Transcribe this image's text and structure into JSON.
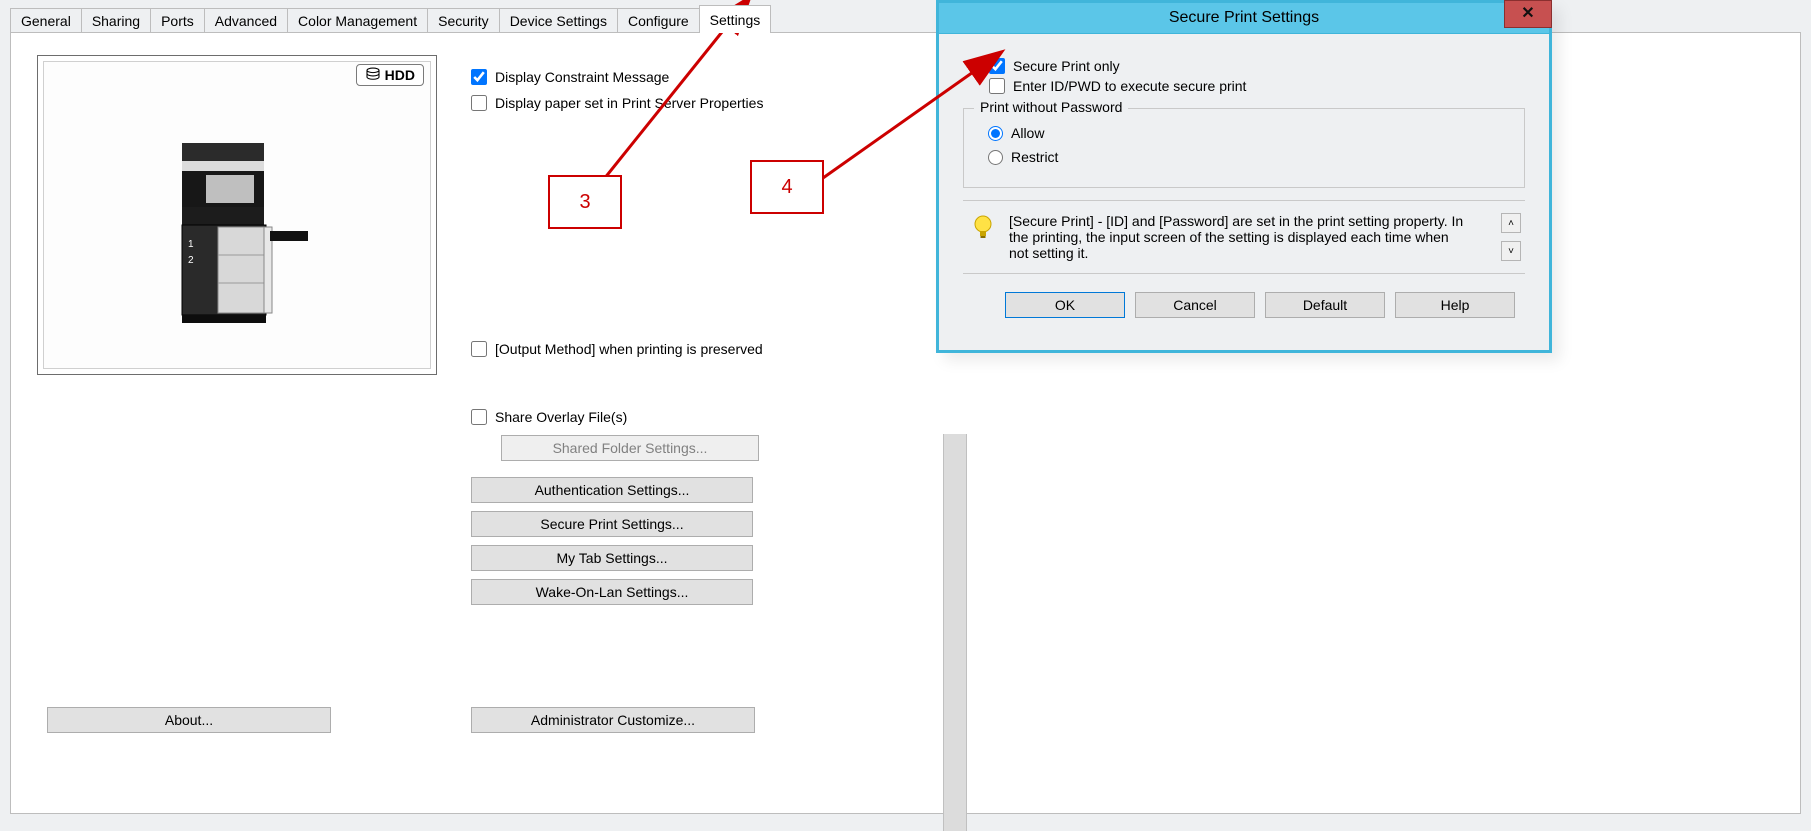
{
  "tabs": [
    "General",
    "Sharing",
    "Ports",
    "Advanced",
    "Color Management",
    "Security",
    "Device Settings",
    "Configure",
    "Settings"
  ],
  "active_tab_index": 8,
  "preview": {
    "hdd_badge": "HDD"
  },
  "settings_tab": {
    "check_constraint": {
      "label": "Display Constraint Message",
      "checked": true
    },
    "check_paper_server": {
      "label": "Display paper set in Print Server Properties",
      "checked": false
    },
    "check_output_method": {
      "label": "[Output Method] when printing is preserved",
      "checked": false
    },
    "check_share_overlay": {
      "label": "Share Overlay File(s)",
      "checked": false
    },
    "btn_shared_folder": "Shared Folder Settings...",
    "btn_auth": "Authentication Settings...",
    "btn_secure_print": "Secure Print Settings...",
    "btn_my_tab": "My Tab Settings...",
    "btn_wol": "Wake-On-Lan Settings...",
    "btn_about": "About...",
    "btn_admin": "Administrator Customize..."
  },
  "modal": {
    "title": "Secure Print Settings",
    "check_secure_only": {
      "label": "Secure Print only",
      "checked": true
    },
    "check_enter_idpwd": {
      "label": "Enter ID/PWD to execute secure print",
      "checked": false
    },
    "group_title": "Print without Password",
    "radio_allow": {
      "label": "Allow",
      "checked": true
    },
    "radio_restrict": {
      "label": "Restrict",
      "checked": false
    },
    "hint_text": "[Secure Print] - [ID] and [Password] are set in the print setting property. In the printing, the input screen of the setting is displayed each time when not setting it.",
    "buttons": {
      "ok": "OK",
      "cancel": "Cancel",
      "default": "Default",
      "help": "Help"
    }
  },
  "callouts": {
    "left": "3",
    "right": "4"
  }
}
